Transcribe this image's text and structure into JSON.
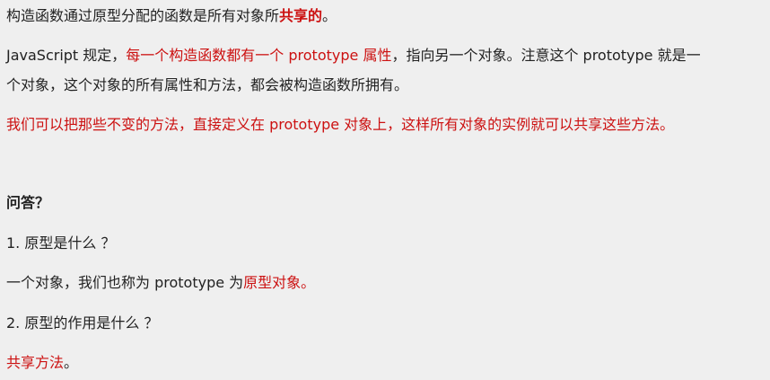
{
  "colors": {
    "text": "#222222",
    "accent_red": "#cc1111",
    "background": "#efefef"
  },
  "p1": {
    "before": "构造函数通过原型分配的函数是所有对象所",
    "highlight": "共享的",
    "after": "。"
  },
  "p2": {
    "line1_before": "JavaScript 规定，",
    "line1_highlight": "每一个构造函数都有一个 prototype 属性",
    "line1_after": "，指向另一个对象。注意这个 prototype 就是一",
    "line2": "个对象，这个对象的所有属性和方法，都会被构造函数所拥有。"
  },
  "p3": "我们可以把那些不变的方法，直接定义在 prototype 对象上，这样所有对象的实例就可以共享这些方法。",
  "qa_heading": "问答？",
  "q1": "1. 原型是什么 ？",
  "a1": {
    "before": "一个对象，我们也称为 prototype 为",
    "highlight": "原型对象。"
  },
  "q2": "2. 原型的作用是什么 ？",
  "a2": {
    "highlight": "共享方法",
    "after": "。"
  }
}
